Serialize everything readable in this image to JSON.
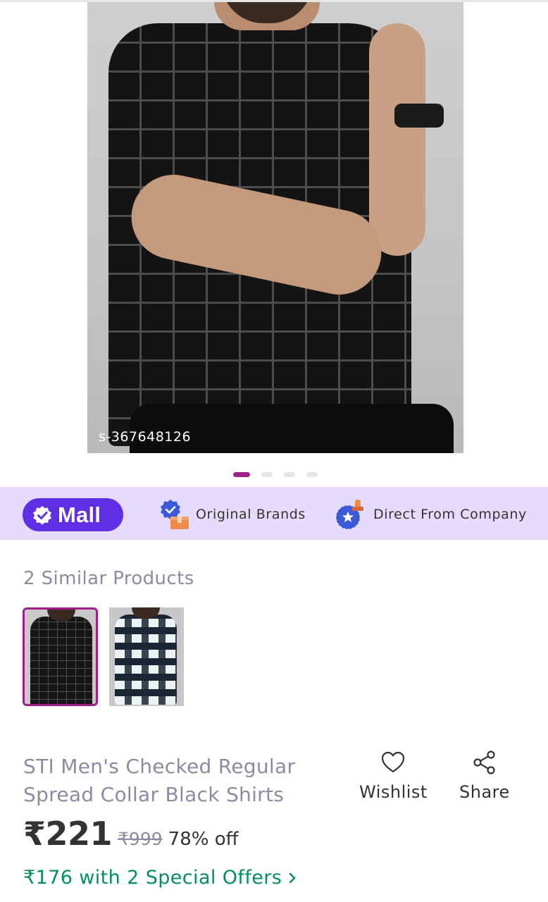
{
  "product_image": {
    "sku_label": "s-367648126",
    "slide_count": 4,
    "active_slide": 1
  },
  "mall_banner": {
    "mall_label": "Mall",
    "features": [
      {
        "label": "Original Brands",
        "icon": "verified-box-icon"
      },
      {
        "label": "Direct From Company",
        "icon": "company-stamp-icon"
      }
    ],
    "colors": {
      "background": "#e5dcfb",
      "pill": "#5f2ee5"
    }
  },
  "similar": {
    "title": "2 Similar Products",
    "items": [
      {
        "name": "black-checked-shirt",
        "selected": true
      },
      {
        "name": "white-black-checked-shirt",
        "selected": false
      }
    ]
  },
  "product": {
    "title": "STI Men's Checked Regular Spread Collar Black Shirts",
    "price": "₹221",
    "mrp": "₹999",
    "discount": "78% off",
    "offers": "₹176 with 2 Special Offers"
  },
  "actions": {
    "wishlist": "Wishlist",
    "share": "Share"
  },
  "colors": {
    "accent": "#9f2089",
    "offer_green": "#038d63",
    "muted_text": "#8b8ba3"
  }
}
